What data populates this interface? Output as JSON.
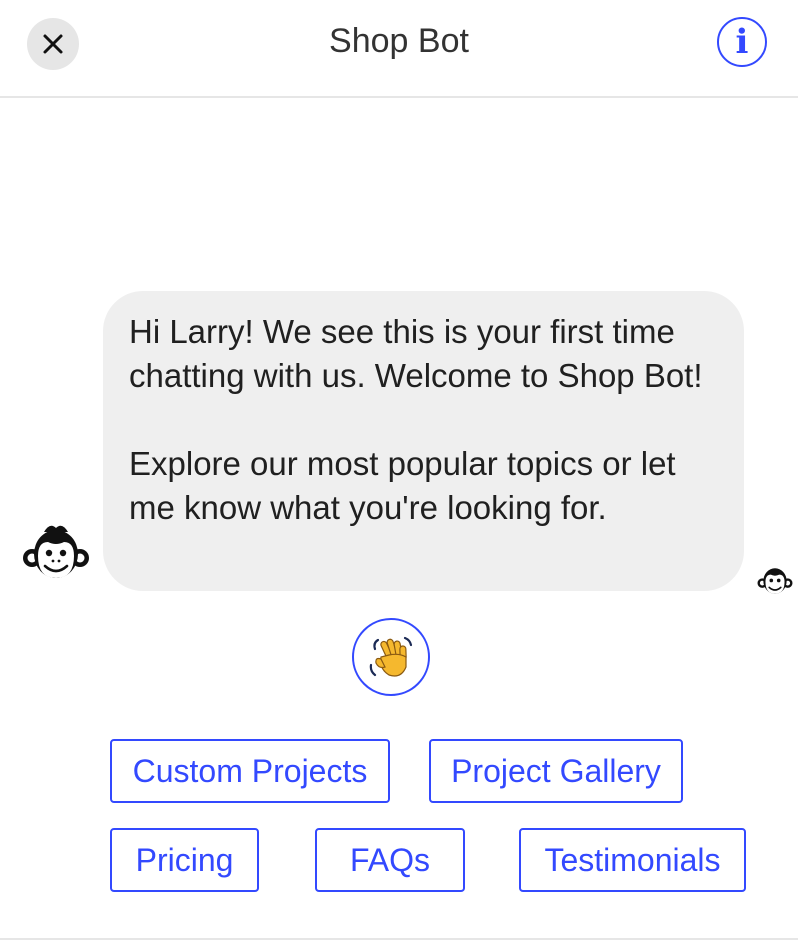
{
  "header": {
    "title": "Shop Bot",
    "close_icon": "close-icon",
    "info_label": "i"
  },
  "message": {
    "paragraph1": "Hi Larry! We see this is your first time chatting with us. Welcome to Shop Bot!",
    "paragraph2": "Explore our most popular topics or let me know what you're looking for."
  },
  "reaction": {
    "icon": "waving-hand-icon"
  },
  "quick_replies": [
    {
      "label": "Custom Projects"
    },
    {
      "label": "Project Gallery"
    },
    {
      "label": "Pricing"
    },
    {
      "label": "FAQs"
    },
    {
      "label": "Testimonials"
    }
  ],
  "colors": {
    "accent": "#3349ff",
    "bubble_bg": "#efefef",
    "header_border": "#e6e6e6"
  }
}
